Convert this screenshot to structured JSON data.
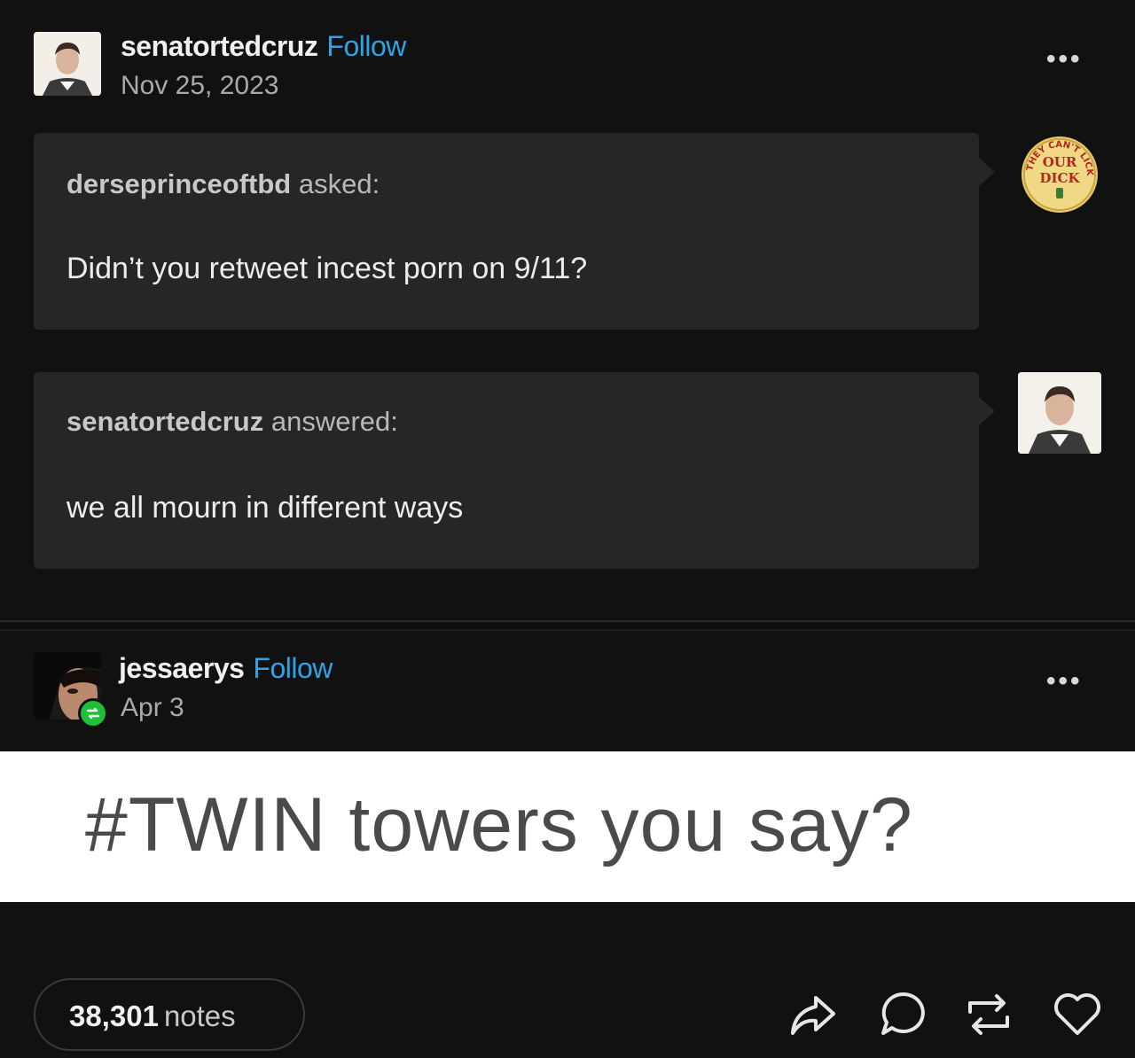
{
  "post1": {
    "username": "senatortedcruz",
    "follow_label": "Follow",
    "date": "Nov 25, 2023",
    "more_label": "•••",
    "ask": {
      "asker": "derseprinceoftbd",
      "asked_label": "asked:",
      "question": "Didn’t you retweet incest porn on 9/11?"
    },
    "answer": {
      "answerer": "senatortedcruz",
      "answered_label": "answered:",
      "text": "we all mourn in different ways"
    },
    "asker_avatar_text": {
      "arc": "THEY CAN'T LICK",
      "line1": "OUR",
      "line2": "DICK"
    }
  },
  "post2": {
    "username": "jessaerys",
    "follow_label": "Follow",
    "date": "Apr 3",
    "more_label": "•••",
    "image_text": "#TWIN towers you say?"
  },
  "footer": {
    "notes_count": "38,301",
    "notes_label": "notes"
  },
  "colors": {
    "background": "#111111",
    "bubble": "#262626",
    "follow": "#2fa3e8",
    "reblog_badge": "#1fbf3a"
  }
}
